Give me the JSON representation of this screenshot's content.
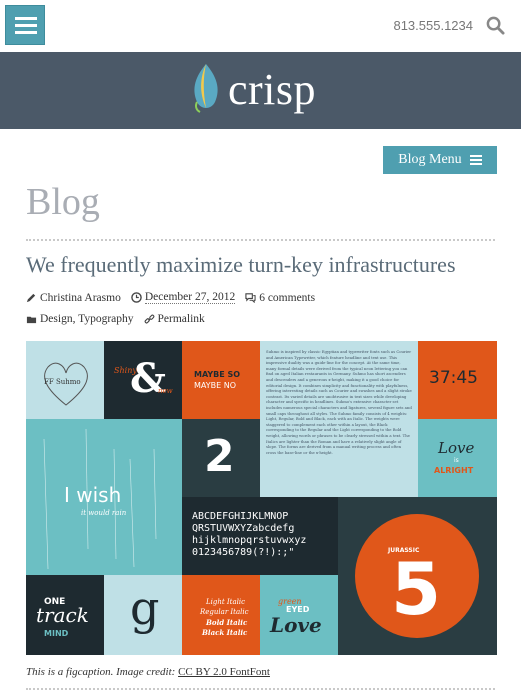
{
  "header": {
    "phone": "813.555.1234",
    "logo_text": "crisp"
  },
  "nav": {
    "blog_menu_label": "Blog Menu"
  },
  "page": {
    "title": "Blog"
  },
  "post": {
    "title": "We frequently maximize turn-key infrastructures",
    "author": "Christina Arasmo",
    "date": "December 27, 2012",
    "comments": "6 comments",
    "categories": "Design, Typography",
    "permalink": "Permalink"
  },
  "figure": {
    "tiles": {
      "ff_suhmo": "FF Suhmo",
      "shiny": "Shiny",
      "new": "new",
      "ampersand": "&",
      "maybe_so_1": "MAYBE SO",
      "maybe_so_2": "MAYBE NO",
      "time": "37:45",
      "two": "2",
      "love": "Love",
      "is": "is",
      "alright": "ALRIGHT",
      "i_wish": "I wish",
      "it_would_rain": "it would rain",
      "alphabet_1": "ABCDEFGHIJKLMNOP",
      "alphabet_2": "QRSTUVWXYZabcdefg",
      "alphabet_3": "hijklmnopqrstuvwxyz",
      "alphabet_4": "0123456789(?!):;\"",
      "jurassic": "JURASSIC",
      "five": "5",
      "one": "ONE",
      "track": "track",
      "mind": "MIND",
      "g": "g",
      "light_italic": "Light Italic",
      "regular_italic": "Regular Italic",
      "bold_italic": "Bold Italic",
      "black_italic": "Black Italic",
      "green": "green",
      "eyed": "EYED",
      "love2": "Love"
    },
    "body_text": "Suhmo is inspired by classic Egyptian and typewriter fonts such as Courier and American Typewriter, which feature headline and text use. This impressive duality was a guide-line for the concept. At the same time, many formal details were derived from the typical neon lettering you can find on aged Italian restaurants in Germany. Suhmo has short ascenders and descenders and a generous x-height, making it a good choice for editorial design. It combines simplicity and functionality with playfulness, offering interesting details such as Courier and swashes and a slight stroke contrast. Its varied details are unobtrusive in text sizes while developing character and specific in headlines. Suhmo's extensive character set includes numerous special characters and ligatures, several figure sets and small caps throughout all styles. The Suhmo family consists of 4 weights: Light, Regular, Bold and Black, each with an Italic. The weights were staggered to complement each other within a layout, the Black corresponding to the Regular and the Light corresponding to the Bold weight, allowing words or phrases to be clearly stressed within a text. The Italics are lighter than the Roman and have a relatively slight angle of slope. The forms are derived from a manual writing process and often cross the base-line or the x-height.",
    "caption_text": "This is a figcaption. Image credit:",
    "caption_link": "CC BY 2.0 FontFont"
  },
  "colors": {
    "accent": "#4f9fb0",
    "brand_bar": "#4b5968",
    "orange": "#e0571a",
    "teal": "#6cbfc3",
    "dark": "#1e2a30",
    "light_blue": "#bfe0e6"
  },
  "icons": {
    "menu": "hamburger-icon",
    "search": "search-icon",
    "author": "pencil-icon",
    "date": "clock-icon",
    "comments": "comments-icon",
    "categories": "folder-icon",
    "permalink": "link-icon",
    "list": "list-icon"
  }
}
